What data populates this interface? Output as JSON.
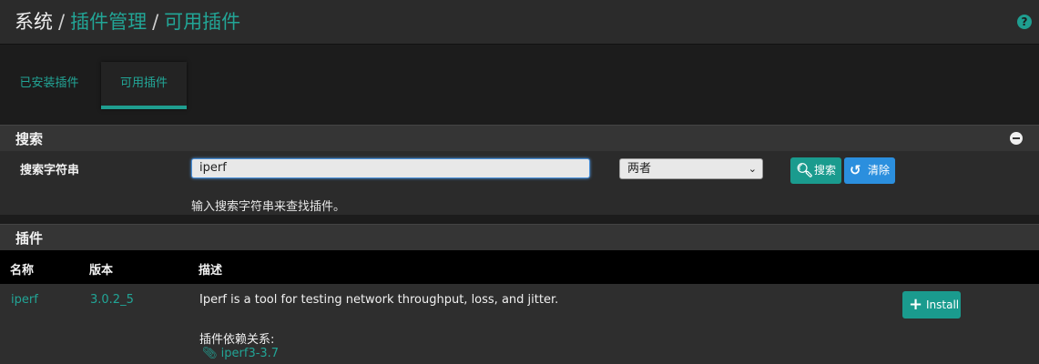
{
  "header": {
    "breadcrumb": [
      "系统",
      "插件管理",
      "可用插件"
    ],
    "help_icon": "question-circle-icon"
  },
  "tabs": [
    {
      "label": "已安装插件",
      "active": false
    },
    {
      "label": "可用插件",
      "active": true
    }
  ],
  "search_panel": {
    "title": "搜索",
    "field_label": "搜索字符串",
    "input_value": "iperf",
    "scope_selected": "两者",
    "search_button": "搜索",
    "clear_button": "清除",
    "help_text": "输入搜索字符串来查找插件。"
  },
  "packages_panel": {
    "title": "插件",
    "columns": [
      "名称",
      "版本",
      "描述"
    ],
    "rows": [
      {
        "name": "iperf",
        "version": "3.0.2_5",
        "description": "Iperf is a tool for testing network throughput, loss, and jitter.",
        "dependencies_label": "插件依赖关系:",
        "dependency": "iperf3-3.7",
        "install_label": "Install"
      }
    ]
  },
  "colors": {
    "accent": "#1f9e90",
    "link": "#22a596",
    "clear": "#2b8fde"
  }
}
